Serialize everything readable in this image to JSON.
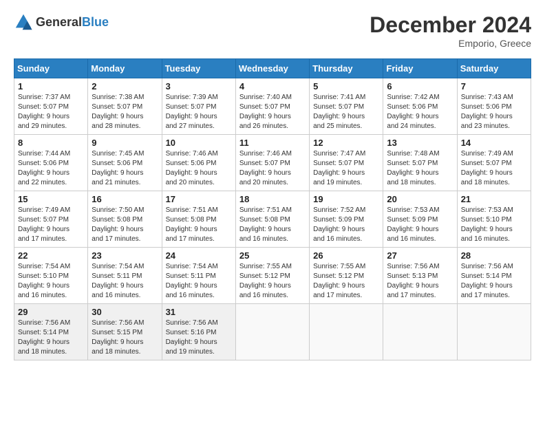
{
  "header": {
    "logo_general": "General",
    "logo_blue": "Blue",
    "month_title": "December 2024",
    "subtitle": "Emporio, Greece"
  },
  "days_of_week": [
    "Sunday",
    "Monday",
    "Tuesday",
    "Wednesday",
    "Thursday",
    "Friday",
    "Saturday"
  ],
  "weeks": [
    [
      {
        "day": 1,
        "info": "Sunrise: 7:37 AM\nSunset: 5:07 PM\nDaylight: 9 hours\nand 29 minutes."
      },
      {
        "day": 2,
        "info": "Sunrise: 7:38 AM\nSunset: 5:07 PM\nDaylight: 9 hours\nand 28 minutes."
      },
      {
        "day": 3,
        "info": "Sunrise: 7:39 AM\nSunset: 5:07 PM\nDaylight: 9 hours\nand 27 minutes."
      },
      {
        "day": 4,
        "info": "Sunrise: 7:40 AM\nSunset: 5:07 PM\nDaylight: 9 hours\nand 26 minutes."
      },
      {
        "day": 5,
        "info": "Sunrise: 7:41 AM\nSunset: 5:07 PM\nDaylight: 9 hours\nand 25 minutes."
      },
      {
        "day": 6,
        "info": "Sunrise: 7:42 AM\nSunset: 5:06 PM\nDaylight: 9 hours\nand 24 minutes."
      },
      {
        "day": 7,
        "info": "Sunrise: 7:43 AM\nSunset: 5:06 PM\nDaylight: 9 hours\nand 23 minutes."
      }
    ],
    [
      {
        "day": 8,
        "info": "Sunrise: 7:44 AM\nSunset: 5:06 PM\nDaylight: 9 hours\nand 22 minutes."
      },
      {
        "day": 9,
        "info": "Sunrise: 7:45 AM\nSunset: 5:06 PM\nDaylight: 9 hours\nand 21 minutes."
      },
      {
        "day": 10,
        "info": "Sunrise: 7:46 AM\nSunset: 5:06 PM\nDaylight: 9 hours\nand 20 minutes."
      },
      {
        "day": 11,
        "info": "Sunrise: 7:46 AM\nSunset: 5:07 PM\nDaylight: 9 hours\nand 20 minutes."
      },
      {
        "day": 12,
        "info": "Sunrise: 7:47 AM\nSunset: 5:07 PM\nDaylight: 9 hours\nand 19 minutes."
      },
      {
        "day": 13,
        "info": "Sunrise: 7:48 AM\nSunset: 5:07 PM\nDaylight: 9 hours\nand 18 minutes."
      },
      {
        "day": 14,
        "info": "Sunrise: 7:49 AM\nSunset: 5:07 PM\nDaylight: 9 hours\nand 18 minutes."
      }
    ],
    [
      {
        "day": 15,
        "info": "Sunrise: 7:49 AM\nSunset: 5:07 PM\nDaylight: 9 hours\nand 17 minutes."
      },
      {
        "day": 16,
        "info": "Sunrise: 7:50 AM\nSunset: 5:08 PM\nDaylight: 9 hours\nand 17 minutes."
      },
      {
        "day": 17,
        "info": "Sunrise: 7:51 AM\nSunset: 5:08 PM\nDaylight: 9 hours\nand 17 minutes."
      },
      {
        "day": 18,
        "info": "Sunrise: 7:51 AM\nSunset: 5:08 PM\nDaylight: 9 hours\nand 16 minutes."
      },
      {
        "day": 19,
        "info": "Sunrise: 7:52 AM\nSunset: 5:09 PM\nDaylight: 9 hours\nand 16 minutes."
      },
      {
        "day": 20,
        "info": "Sunrise: 7:53 AM\nSunset: 5:09 PM\nDaylight: 9 hours\nand 16 minutes."
      },
      {
        "day": 21,
        "info": "Sunrise: 7:53 AM\nSunset: 5:10 PM\nDaylight: 9 hours\nand 16 minutes."
      }
    ],
    [
      {
        "day": 22,
        "info": "Sunrise: 7:54 AM\nSunset: 5:10 PM\nDaylight: 9 hours\nand 16 minutes."
      },
      {
        "day": 23,
        "info": "Sunrise: 7:54 AM\nSunset: 5:11 PM\nDaylight: 9 hours\nand 16 minutes."
      },
      {
        "day": 24,
        "info": "Sunrise: 7:54 AM\nSunset: 5:11 PM\nDaylight: 9 hours\nand 16 minutes."
      },
      {
        "day": 25,
        "info": "Sunrise: 7:55 AM\nSunset: 5:12 PM\nDaylight: 9 hours\nand 16 minutes."
      },
      {
        "day": 26,
        "info": "Sunrise: 7:55 AM\nSunset: 5:12 PM\nDaylight: 9 hours\nand 17 minutes."
      },
      {
        "day": 27,
        "info": "Sunrise: 7:56 AM\nSunset: 5:13 PM\nDaylight: 9 hours\nand 17 minutes."
      },
      {
        "day": 28,
        "info": "Sunrise: 7:56 AM\nSunset: 5:14 PM\nDaylight: 9 hours\nand 17 minutes."
      }
    ],
    [
      {
        "day": 29,
        "info": "Sunrise: 7:56 AM\nSunset: 5:14 PM\nDaylight: 9 hours\nand 18 minutes."
      },
      {
        "day": 30,
        "info": "Sunrise: 7:56 AM\nSunset: 5:15 PM\nDaylight: 9 hours\nand 18 minutes."
      },
      {
        "day": 31,
        "info": "Sunrise: 7:56 AM\nSunset: 5:16 PM\nDaylight: 9 hours\nand 19 minutes."
      },
      null,
      null,
      null,
      null
    ]
  ]
}
